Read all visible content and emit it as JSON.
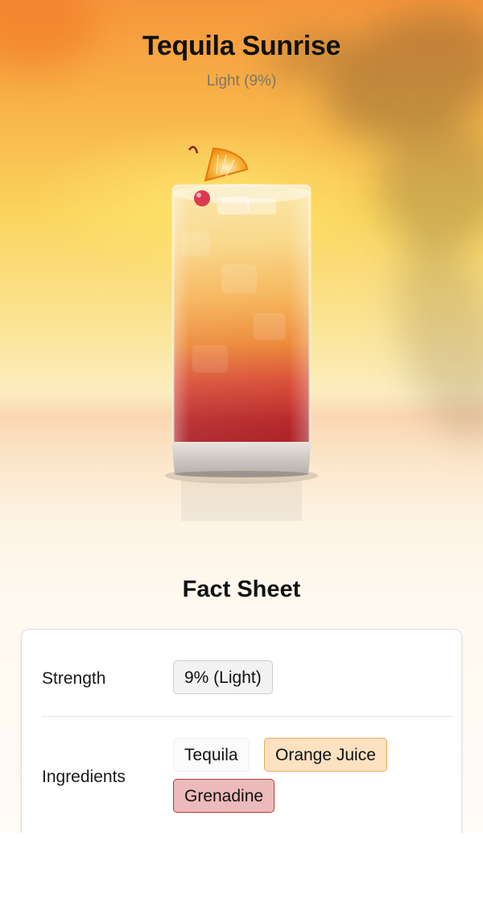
{
  "drink": {
    "name": "Tequila Sunrise",
    "strength_subtitle": "Light (9%)"
  },
  "fact_sheet": {
    "title": "Fact Sheet",
    "strength_label": "Strength",
    "strength_value": "9% (Light)",
    "ingredients_label": "Ingredients",
    "ingredients": [
      "Tequila",
      "Orange Juice",
      "Grenadine"
    ]
  },
  "colors": {
    "orange_juice_chip": "#fde1c1",
    "grenadine_chip": "#ecbaba",
    "tequila_chip": "#fbfbfb"
  },
  "icons": {
    "hero_image": "tequila-sunrise-glass-illustration"
  }
}
